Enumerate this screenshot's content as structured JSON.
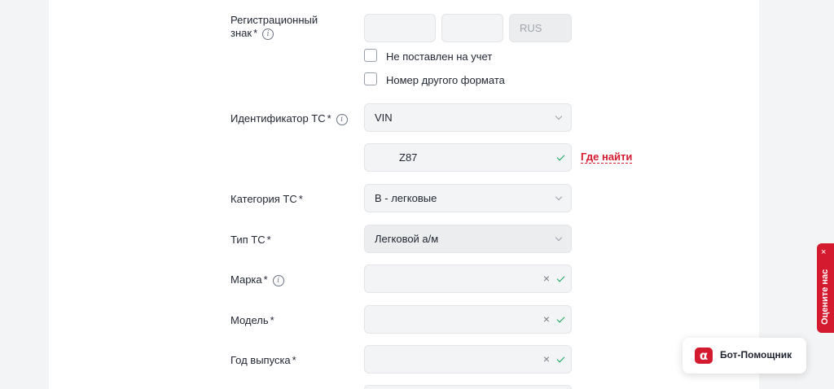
{
  "form": {
    "reg": {
      "label_line1": "Регистрационный",
      "label_line2": "знак",
      "required": "*",
      "info": "i",
      "country": "RUS"
    },
    "checkbox1": "Не поставлен на учет",
    "checkbox2": "Номер другого формата",
    "vehicle_id": {
      "label": "Идентификатор ТС",
      "required": "*",
      "info": "i",
      "value": "VIN"
    },
    "vin": {
      "value": "Z87",
      "where_link": "Где найти"
    },
    "category": {
      "label": "Категория ТС",
      "required": "*",
      "value": "B - легковые"
    },
    "type": {
      "label": "Тип ТС",
      "required": "*",
      "value": "Легковой а/м"
    },
    "brand": {
      "label": "Марка",
      "required": "*",
      "info": "i",
      "clear": "×"
    },
    "model": {
      "label": "Модель",
      "required": "*",
      "clear": "×"
    },
    "year": {
      "label": "Год выпуска",
      "required": "*",
      "clear": "×"
    }
  },
  "widgets": {
    "rate_us": "Оцените нас",
    "rate_close": "×",
    "bot_label": "Бот-Помощник",
    "bot_logo": "α"
  },
  "colors": {
    "accent": "#d41a2e",
    "success": "#14a05a",
    "field_bg": "#f3f4f5"
  }
}
